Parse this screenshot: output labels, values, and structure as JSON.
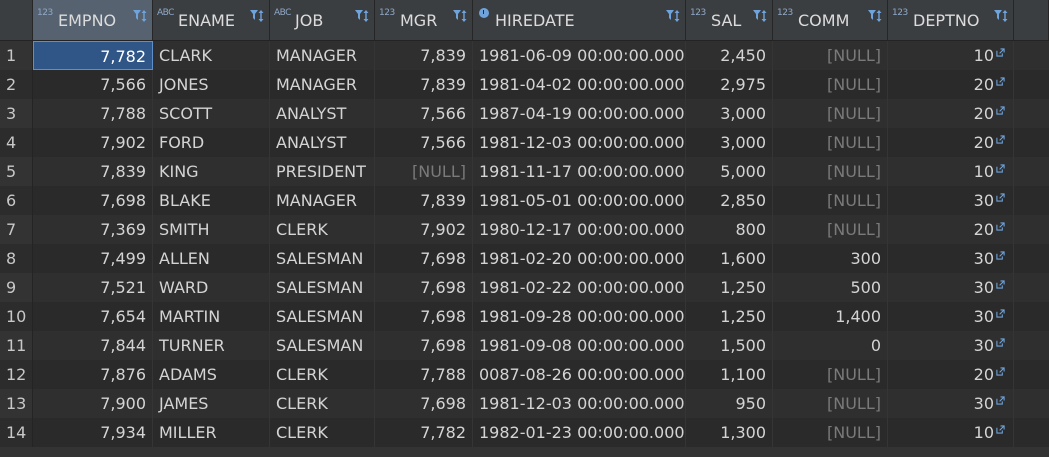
{
  "columns": [
    {
      "key": "empno",
      "label": "EMPNO",
      "type": "123"
    },
    {
      "key": "ename",
      "label": "ENAME",
      "type": "ABC"
    },
    {
      "key": "job",
      "label": "JOB",
      "type": "ABC"
    },
    {
      "key": "mgr",
      "label": "MGR",
      "type": "123"
    },
    {
      "key": "hiredate",
      "label": "HIREDATE",
      "type": "clock"
    },
    {
      "key": "sal",
      "label": "SAL",
      "type": "123"
    },
    {
      "key": "comm",
      "label": "COMM",
      "type": "123"
    },
    {
      "key": "deptno",
      "label": "DEPTNO",
      "type": "123"
    }
  ],
  "rows": [
    {
      "num": "1",
      "empno": "7,782",
      "ename": "CLARK",
      "job": "MANAGER",
      "mgr": "7,839",
      "hiredate": "1981-06-09 00:00:00.000",
      "sal": "2,450",
      "comm": "[NULL]",
      "deptno": "10"
    },
    {
      "num": "2",
      "empno": "7,566",
      "ename": "JONES",
      "job": "MANAGER",
      "mgr": "7,839",
      "hiredate": "1981-04-02 00:00:00.000",
      "sal": "2,975",
      "comm": "[NULL]",
      "deptno": "20"
    },
    {
      "num": "3",
      "empno": "7,788",
      "ename": "SCOTT",
      "job": "ANALYST",
      "mgr": "7,566",
      "hiredate": "1987-04-19 00:00:00.000",
      "sal": "3,000",
      "comm": "[NULL]",
      "deptno": "20"
    },
    {
      "num": "4",
      "empno": "7,902",
      "ename": "FORD",
      "job": "ANALYST",
      "mgr": "7,566",
      "hiredate": "1981-12-03 00:00:00.000",
      "sal": "3,000",
      "comm": "[NULL]",
      "deptno": "20"
    },
    {
      "num": "5",
      "empno": "7,839",
      "ename": "KING",
      "job": "PRESIDENT",
      "mgr": "[NULL]",
      "hiredate": "1981-11-17 00:00:00.000",
      "sal": "5,000",
      "comm": "[NULL]",
      "deptno": "10"
    },
    {
      "num": "6",
      "empno": "7,698",
      "ename": "BLAKE",
      "job": "MANAGER",
      "mgr": "7,839",
      "hiredate": "1981-05-01 00:00:00.000",
      "sal": "2,850",
      "comm": "[NULL]",
      "deptno": "30"
    },
    {
      "num": "7",
      "empno": "7,369",
      "ename": "SMITH",
      "job": "CLERK",
      "mgr": "7,902",
      "hiredate": "1980-12-17 00:00:00.000",
      "sal": "800",
      "comm": "[NULL]",
      "deptno": "20"
    },
    {
      "num": "8",
      "empno": "7,499",
      "ename": "ALLEN",
      "job": "SALESMAN",
      "mgr": "7,698",
      "hiredate": "1981-02-20 00:00:00.000",
      "sal": "1,600",
      "comm": "300",
      "deptno": "30"
    },
    {
      "num": "9",
      "empno": "7,521",
      "ename": "WARD",
      "job": "SALESMAN",
      "mgr": "7,698",
      "hiredate": "1981-02-22 00:00:00.000",
      "sal": "1,250",
      "comm": "500",
      "deptno": "30"
    },
    {
      "num": "10",
      "empno": "7,654",
      "ename": "MARTIN",
      "job": "SALESMAN",
      "mgr": "7,698",
      "hiredate": "1981-09-28 00:00:00.000",
      "sal": "1,250",
      "comm": "1,400",
      "deptno": "30"
    },
    {
      "num": "11",
      "empno": "7,844",
      "ename": "TURNER",
      "job": "SALESMAN",
      "mgr": "7,698",
      "hiredate": "1981-09-08 00:00:00.000",
      "sal": "1,500",
      "comm": "0",
      "deptno": "30"
    },
    {
      "num": "12",
      "empno": "7,876",
      "ename": "ADAMS",
      "job": "CLERK",
      "mgr": "7,788",
      "hiredate": "0087-08-26 00:00:00.000",
      "sal": "1,100",
      "comm": "[NULL]",
      "deptno": "20"
    },
    {
      "num": "13",
      "empno": "7,900",
      "ename": "JAMES",
      "job": "CLERK",
      "mgr": "7,698",
      "hiredate": "1981-12-03 00:00:00.000",
      "sal": "950",
      "comm": "[NULL]",
      "deptno": "30"
    },
    {
      "num": "14",
      "empno": "7,934",
      "ename": "MILLER",
      "job": "CLERK",
      "mgr": "7,782",
      "hiredate": "1982-01-23 00:00:00.000",
      "sal": "1,300",
      "comm": "[NULL]",
      "deptno": "10"
    }
  ],
  "colors": {
    "selected_cell": "#2f5686",
    "accent": "#6fa3dc",
    "null_text": "#7a7a7a"
  }
}
